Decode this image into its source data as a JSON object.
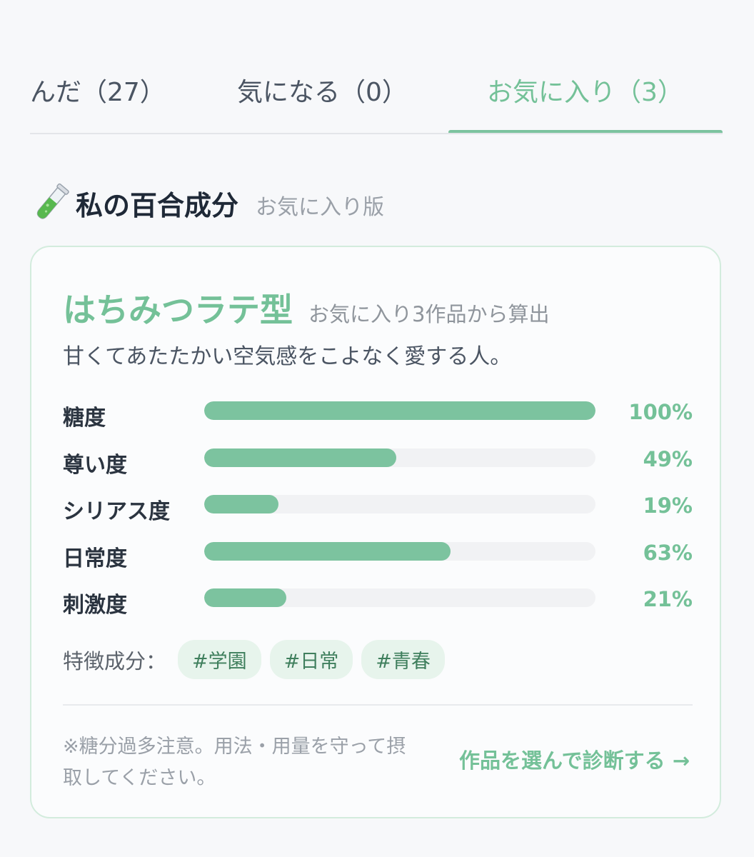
{
  "tabs": [
    {
      "label": "んだ（27）",
      "active": false
    },
    {
      "label": "気になる（0）",
      "active": false
    },
    {
      "label": "お気に入り（3）",
      "active": true
    }
  ],
  "section": {
    "icon": "test-tube-icon",
    "title": "私の百合成分",
    "subtitle": "お気に入り版"
  },
  "card": {
    "type_name": "はちみつラテ型",
    "type_source": "お気に入り3作品から算出",
    "description": "甘くてあたたかい空気感をこよなく愛する人。",
    "stats": [
      {
        "label": "糖度",
        "value": 100,
        "display": "100%"
      },
      {
        "label": "尊い度",
        "value": 49,
        "display": "49%"
      },
      {
        "label": "シリアス度",
        "value": 19,
        "display": "19%"
      },
      {
        "label": "日常度",
        "value": 63,
        "display": "63%"
      },
      {
        "label": "刺激度",
        "value": 21,
        "display": "21%"
      }
    ],
    "traits_label": "特徴成分：",
    "tags": [
      "#学園",
      "#日常",
      "#青春"
    ],
    "disclaimer": "※糖分過多注意。用法・用量を守って摂取してください。",
    "cta_label": "作品を選んで診断する →"
  },
  "colors": {
    "accent": "#74c198",
    "bar_fill": "#7cc39f",
    "bar_track": "#f1f2f4",
    "tag_bg": "#e7f4ec",
    "card_border": "#d3ecdd"
  }
}
